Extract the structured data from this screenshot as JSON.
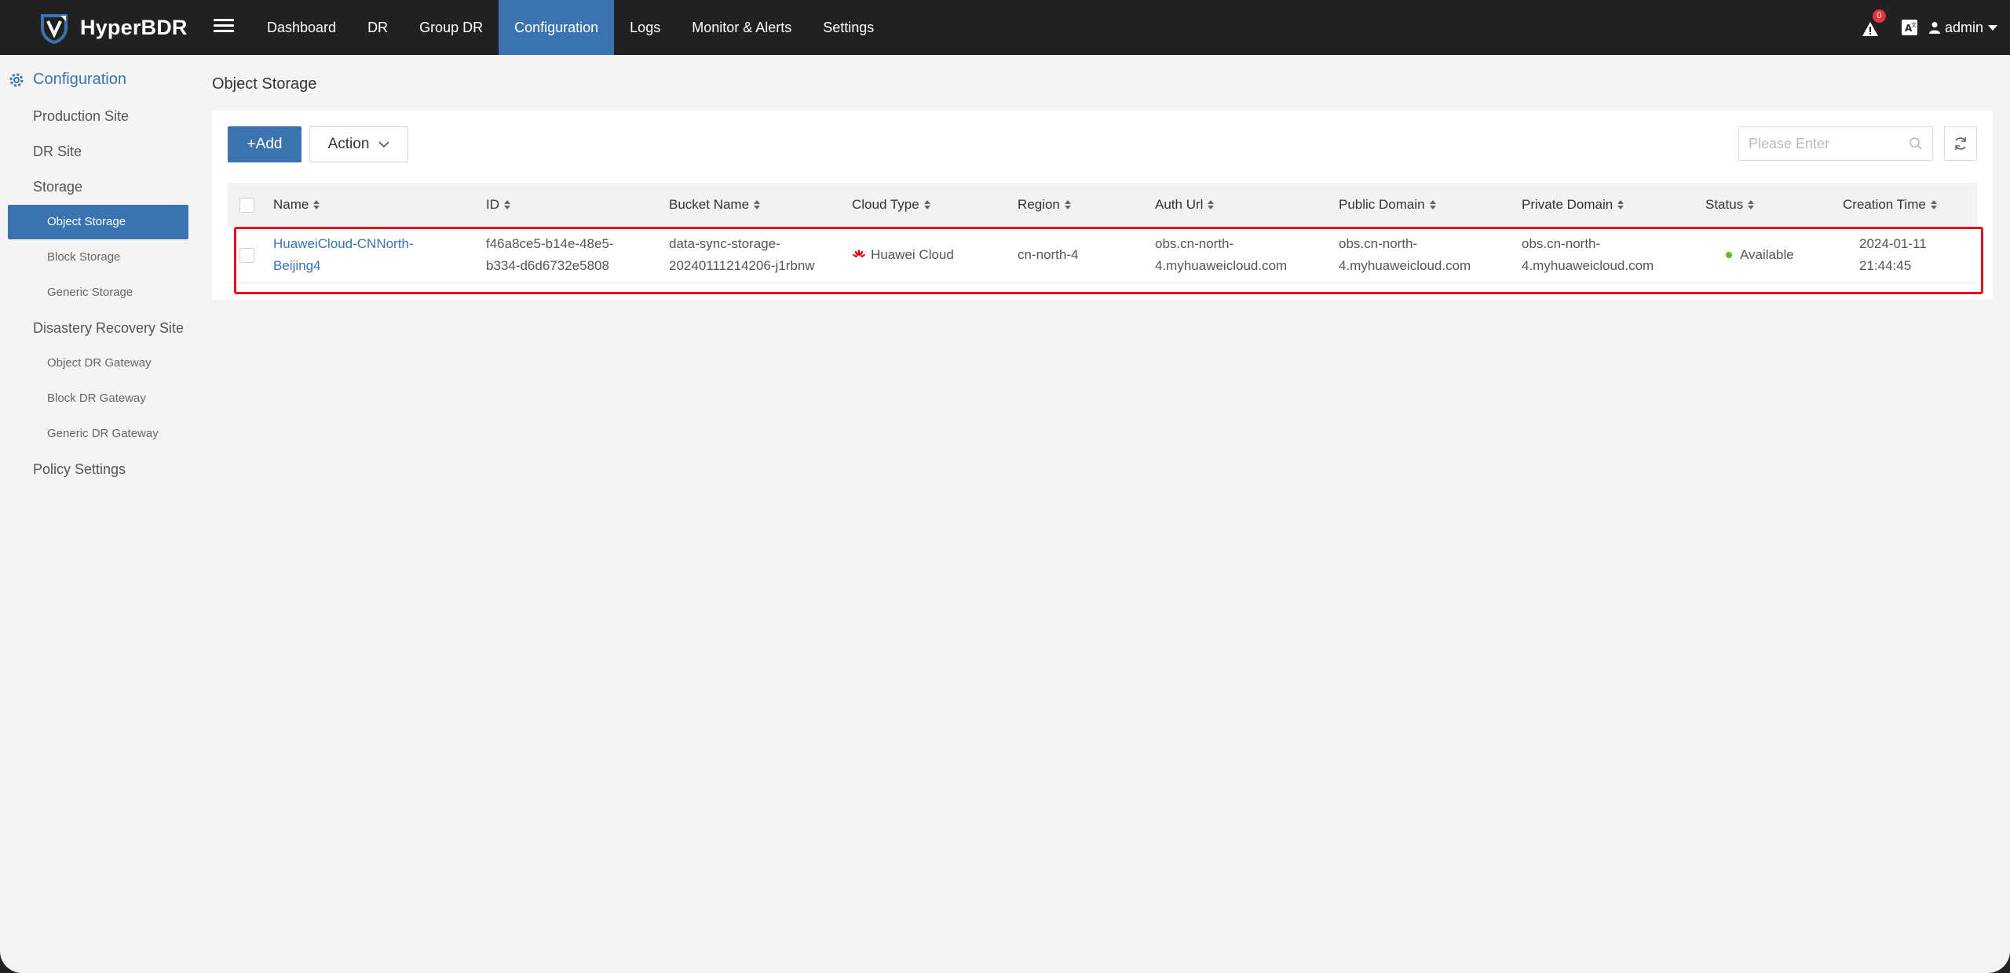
{
  "app": {
    "name": "HyperBDR"
  },
  "nav": {
    "items": [
      {
        "label": "Dashboard"
      },
      {
        "label": "DR"
      },
      {
        "label": "Group DR"
      },
      {
        "label": "Configuration"
      },
      {
        "label": "Logs"
      },
      {
        "label": "Monitor & Alerts"
      },
      {
        "label": "Settings"
      }
    ],
    "active": "Configuration",
    "alert_count": "0",
    "user": "admin"
  },
  "sidebar": {
    "header": "Configuration",
    "items": [
      {
        "label": "Production Site"
      },
      {
        "label": "DR Site"
      },
      {
        "label": "Storage"
      },
      {
        "label": "Object Storage"
      },
      {
        "label": "Block Storage"
      },
      {
        "label": "Generic Storage"
      },
      {
        "label": "Disastery Recovery Site"
      },
      {
        "label": "Object DR Gateway"
      },
      {
        "label": "Block DR Gateway"
      },
      {
        "label": "Generic DR Gateway"
      },
      {
        "label": "Policy Settings"
      }
    ],
    "active": "Object Storage"
  },
  "page": {
    "title": "Object Storage"
  },
  "toolbar": {
    "add_label": "+Add",
    "action_label": "Action",
    "search_placeholder": "Please Enter"
  },
  "table": {
    "columns": [
      "Name",
      "ID",
      "Bucket Name",
      "Cloud Type",
      "Region",
      "Auth Url",
      "Public Domain",
      "Private Domain",
      "Status",
      "Creation Time"
    ],
    "rows": [
      {
        "name_line1": "HuaweiCloud-CNNorth-",
        "name_line2": "Beijing4",
        "id_line1": "f46a8ce5-b14e-48e5-",
        "id_line2": "b334-d6d6732e5808",
        "bucket_line1": "data-sync-storage-",
        "bucket_line2": "20240111214206-j1rbnw",
        "cloud_type": "Huawei Cloud",
        "region": "cn-north-4",
        "auth_line1": "obs.cn-north-",
        "auth_line2": "4.myhuaweicloud.com",
        "public_line1": "obs.cn-north-",
        "public_line2": "4.myhuaweicloud.com",
        "private_line1": "obs.cn-north-",
        "private_line2": "4.myhuaweicloud.com",
        "status": "Available",
        "created": "2024-01-11 21:44:45"
      }
    ]
  },
  "colors": {
    "accent": "#3b73b0",
    "topbar": "#212121",
    "status_ok": "#52c41a",
    "highlight": "#e60f1e",
    "huawei_red": "#e60012"
  }
}
